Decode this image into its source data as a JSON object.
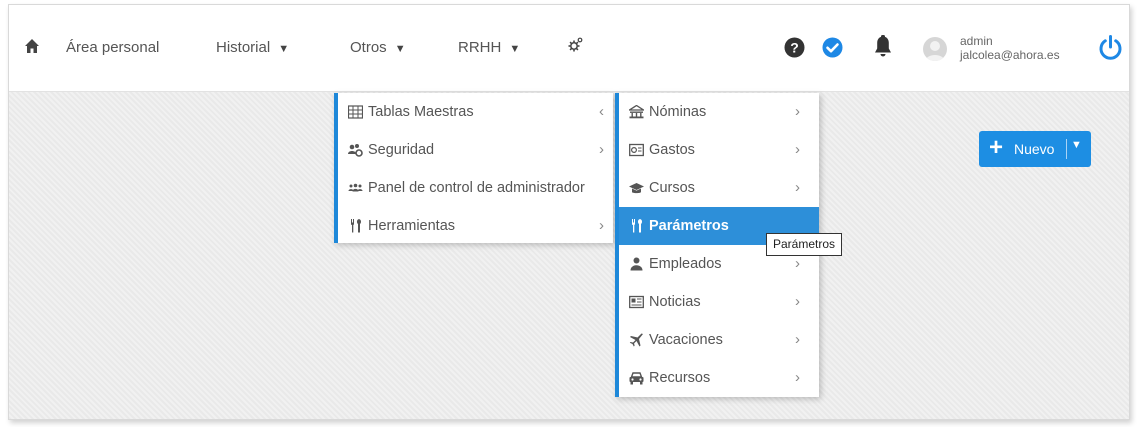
{
  "topbar": {
    "nav": {
      "home_icon": "home-icon",
      "area_personal": "Área personal",
      "historial": "Historial",
      "otros": "Otros",
      "rrhh": "RRHH",
      "caret": "▼",
      "settings_icon": "cog-icon"
    },
    "user": {
      "name": "admin",
      "email": "jalcolea@ahora.es"
    },
    "icons": [
      "help-icon",
      "check-circle-icon",
      "bell-icon",
      "avatar",
      "power-icon"
    ],
    "accent_color": "#1e88d9"
  },
  "otros_menu": {
    "items": [
      {
        "label": "Tablas Maestras",
        "icon": "table-icon",
        "chevron": "‹"
      },
      {
        "label": "Seguridad",
        "icon": "users-cog-icon",
        "chevron": "›"
      },
      {
        "label": "Panel de control de administrador",
        "icon": "group-icon",
        "chevron": ""
      },
      {
        "label": "Herramientas",
        "icon": "wrench-icon",
        "chevron": "›"
      }
    ]
  },
  "rrhh_submenu": {
    "items": [
      {
        "label": "Nóminas",
        "icon": "bank-icon",
        "chevron": "›"
      },
      {
        "label": "Gastos",
        "icon": "receipt-icon",
        "chevron": "›"
      },
      {
        "label": "Cursos",
        "icon": "graduation-cap-icon",
        "chevron": "›"
      },
      {
        "label": "Parámetros",
        "icon": "wrench-icon",
        "chevron": "",
        "active": true
      },
      {
        "label": "Empleados",
        "icon": "user-icon",
        "chevron": "›"
      },
      {
        "label": "Noticias",
        "icon": "newspaper-icon",
        "chevron": "›"
      },
      {
        "label": "Vacaciones",
        "icon": "plane-icon",
        "chevron": "›"
      },
      {
        "label": "Recursos",
        "icon": "car-icon",
        "chevron": "›"
      }
    ]
  },
  "tooltip": "Parámetros",
  "new_button": {
    "plus": "+",
    "label": "Nuevo",
    "dropdown": "▼",
    "color": "#1d8ee3"
  }
}
